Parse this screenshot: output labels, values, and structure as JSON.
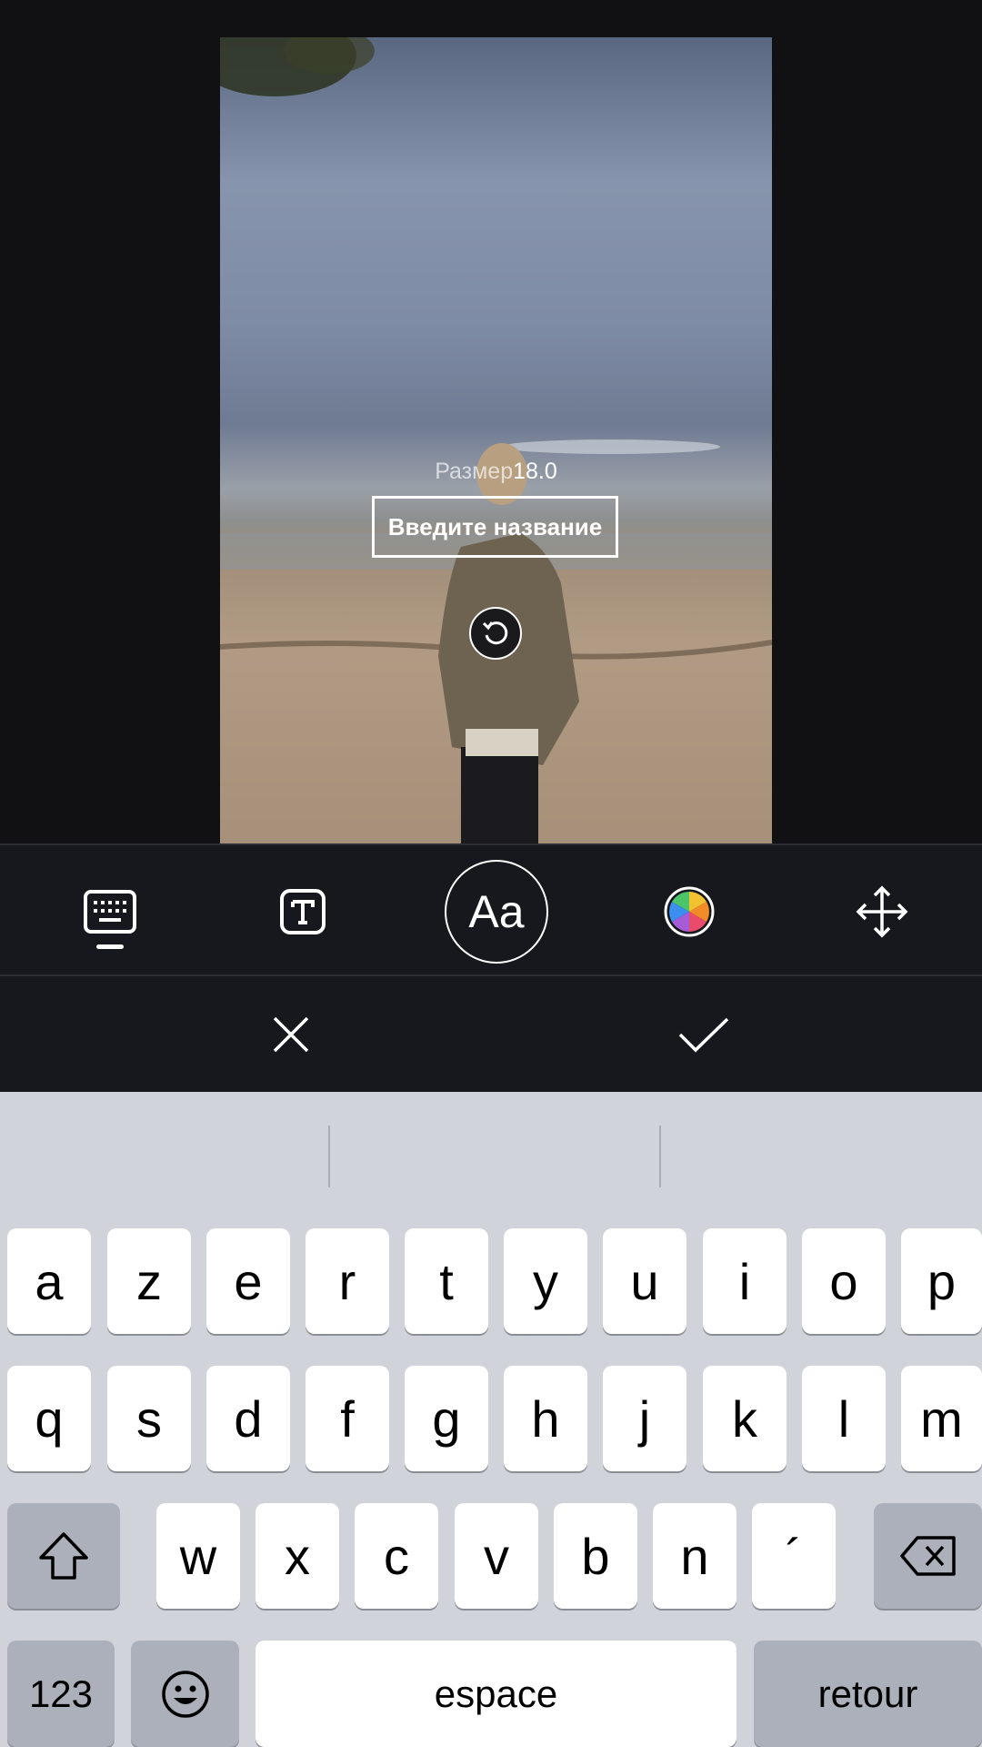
{
  "canvas": {
    "size_label": "Размер",
    "size_value": "18.0",
    "title_placeholder": "Введите название"
  },
  "toolbar": {
    "tools": [
      "keyboard-icon",
      "text-style-icon",
      "font-icon",
      "color-wheel-icon",
      "move-icon"
    ],
    "font_button_label": "Aa",
    "active_tool": "keyboard"
  },
  "actions": {
    "cancel": "close-icon",
    "confirm": "checkmark-icon"
  },
  "keyboard": {
    "row1": [
      "a",
      "z",
      "e",
      "r",
      "t",
      "y",
      "u",
      "i",
      "o",
      "p"
    ],
    "row2": [
      "q",
      "s",
      "d",
      "f",
      "g",
      "h",
      "j",
      "k",
      "l",
      "m"
    ],
    "row3": [
      "w",
      "x",
      "c",
      "v",
      "b",
      "n",
      "´"
    ],
    "numbers_label": "123",
    "space_label": "espace",
    "return_label": "retour"
  }
}
